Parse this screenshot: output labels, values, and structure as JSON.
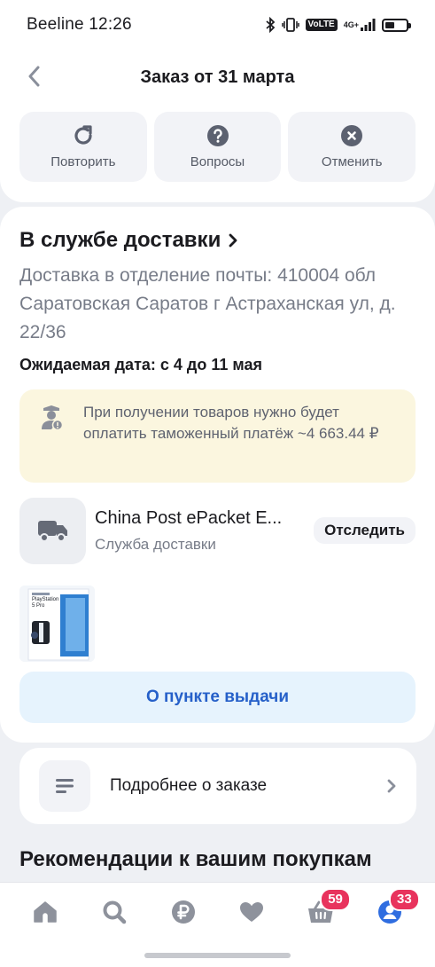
{
  "status_bar": {
    "carrier": "Beeline",
    "time": "12:26",
    "network": "4G+",
    "volte": "VoLTE"
  },
  "header": {
    "title": "Заказ от 31 марта"
  },
  "actions": [
    {
      "label": "Повторить",
      "icon": "repeat-icon"
    },
    {
      "label": "Вопросы",
      "icon": "question-icon"
    },
    {
      "label": "Отменить",
      "icon": "cancel-icon"
    }
  ],
  "delivery": {
    "status": "В службе доставки",
    "address": "Доставка в отделение почты: 410004 обл Саратовская Саратов г Астраханская ул, д. 22/36",
    "expected_date": "Ожидаемая дата: с 4 до 11 мая",
    "customs_notice": "При получении товаров нужно будет оплатить таможенный платёж ~4 663.44 ₽",
    "carrier_name": "China Post ePacket E...",
    "carrier_sub": "Служба доставки",
    "track_label": "Отследить",
    "product_box_text": "PlayStation 5 Pro",
    "pickup_label": "О пункте выдачи"
  },
  "details": {
    "label": "Подробнее о заказе"
  },
  "recommendations": {
    "title": "Рекомендации к вашим покупкам"
  },
  "bottom_nav": {
    "items": [
      {
        "name": "home",
        "icon": "home-icon"
      },
      {
        "name": "search",
        "icon": "search-icon"
      },
      {
        "name": "payments",
        "icon": "ruble-icon"
      },
      {
        "name": "favorites",
        "icon": "heart-icon"
      },
      {
        "name": "cart",
        "icon": "basket-icon",
        "badge": "59"
      },
      {
        "name": "profile",
        "icon": "profile-icon",
        "badge": "33"
      }
    ]
  },
  "colors": {
    "accent": "#2660c9",
    "badge": "#e8335d",
    "notice_bg": "#fbf6df",
    "active_nav": "#2f6de0"
  }
}
